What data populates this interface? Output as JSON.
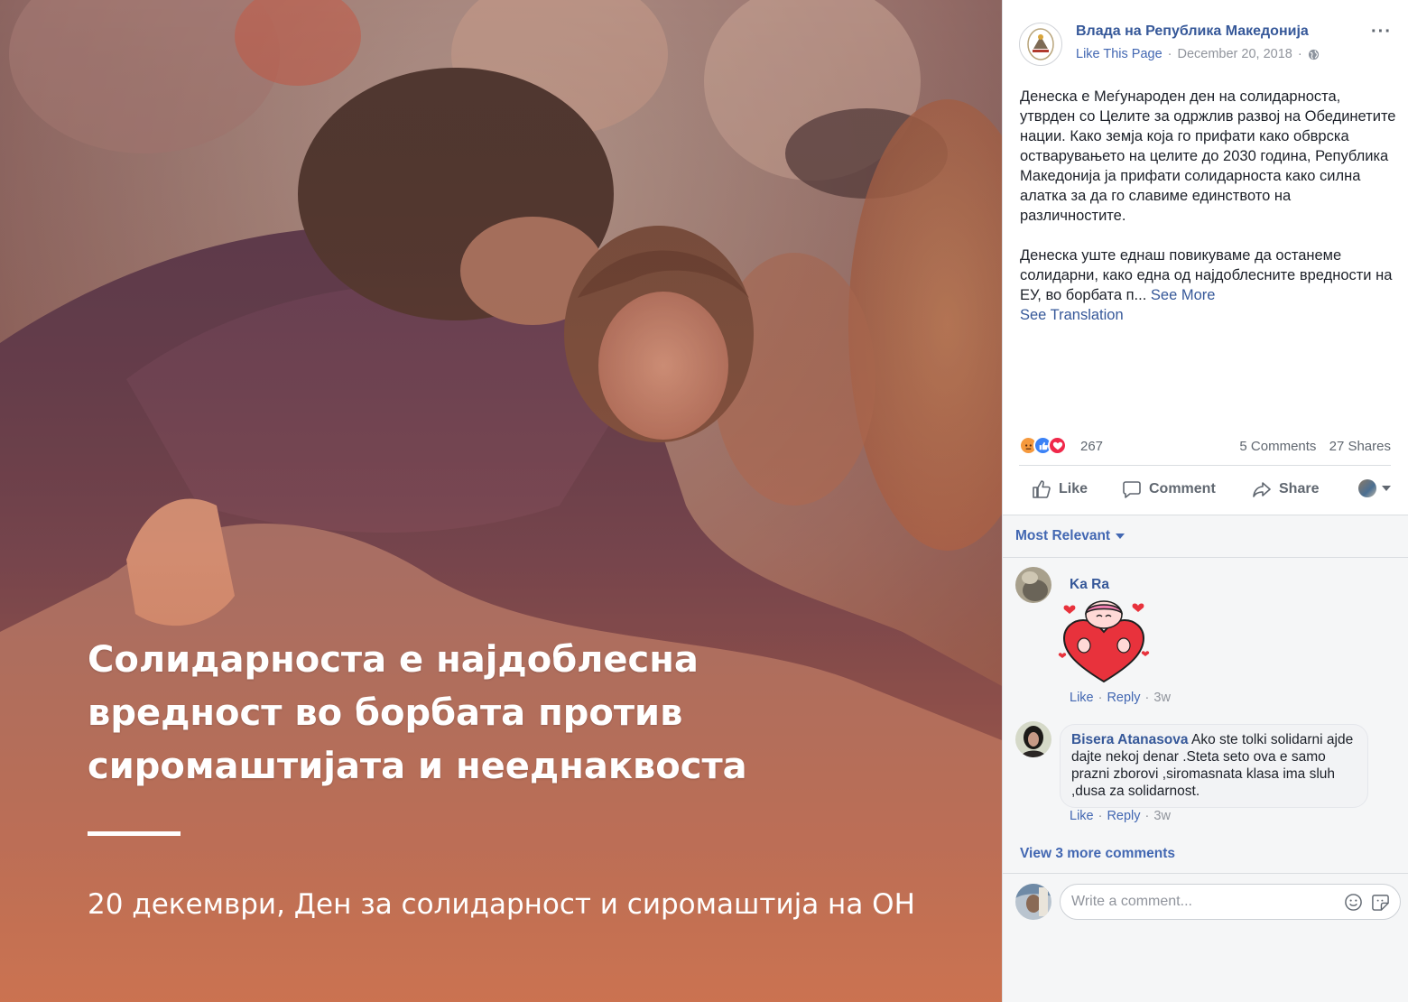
{
  "photo": {
    "headline_lines": [
      "Солидарноста е најдоблесна",
      "вредност во борбата против",
      "сиромаштијата и нееднаквоста"
    ],
    "subline": "20 декември, Ден за солидарност и сиромаштија на ОН"
  },
  "post": {
    "page_name": "Влада на Република Македонија",
    "like_page": "Like This Page",
    "date": "December 20, 2018",
    "dot": "·",
    "more": "···",
    "paragraph1": "Денеска е Меѓународен ден на солидарноста, утврден со Целите за одржлив развој на Обединетите нации. Како земја која го прифати како обврска остварувањето на целите до 2030 година, Република Македонија ја прифати солидарноста како силна алатка за да го славиме единството на различностите.",
    "paragraph2": "Денеска уште еднаш повикуваме да останеме солидарни, како една од најдоблесните вредности на ЕУ, во борбата п...",
    "see_more": "See More",
    "see_translation": "See Translation",
    "reaction_count": "267",
    "comments_count": "5 Comments",
    "shares_count": "27 Shares",
    "actions": {
      "like": "Like",
      "comment": "Comment",
      "share": "Share"
    }
  },
  "comments": {
    "sort_label": "Most Relevant",
    "items": [
      {
        "author": "Ka Ra",
        "text": "",
        "like": "Like",
        "reply": "Reply",
        "time": "3w"
      },
      {
        "author": "Bisera Atanasova",
        "text": "Ako ste tolki solidarni ajde dajte nekoj denar .Steta seto ova e samo prazni zborovi ,siromasnata klasa ima sluh ,dusa za solidarnost.",
        "like": "Like",
        "reply": "Reply",
        "time": "3w"
      }
    ],
    "view_more": "View 3 more comments",
    "write_placeholder": "Write a comment...",
    "sep": "·"
  },
  "colors": {
    "link": "#365899",
    "accent": "#4267b2",
    "muted": "#90949c"
  }
}
